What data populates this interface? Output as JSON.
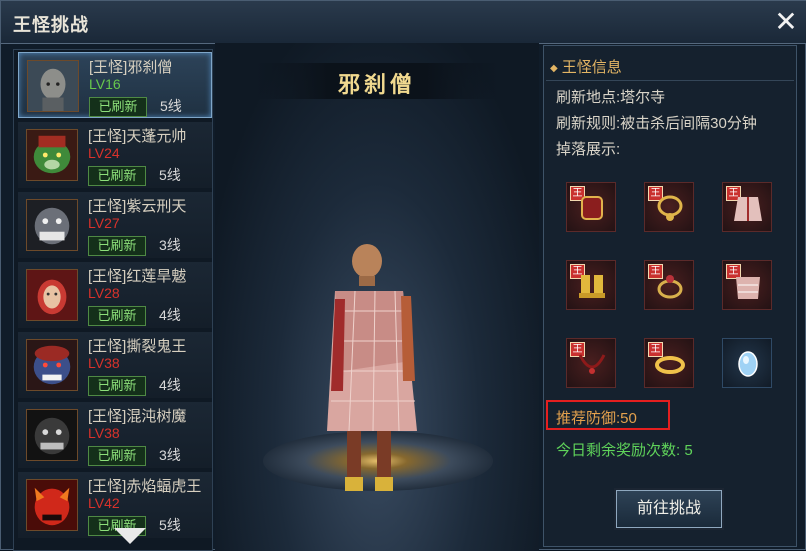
{
  "window": {
    "title": "王怪挑战"
  },
  "boss_list": [
    {
      "name": "[王怪]邪刹僧",
      "level": "LV16",
      "status": "已刷新",
      "line": "5线",
      "selected": true,
      "level_color": "#67c84c",
      "avatar_icon": "bald-monk-face-icon"
    },
    {
      "name": "[王怪]天蓬元帅",
      "level": "LV24",
      "status": "已刷新",
      "line": "5线",
      "level_color": "#d8322b",
      "avatar_icon": "green-boar-face-icon"
    },
    {
      "name": "[王怪]紫云刑天",
      "level": "LV27",
      "status": "已刷新",
      "line": "3线",
      "level_color": "#d8322b",
      "avatar_icon": "gray-demon-face-icon"
    },
    {
      "name": "[王怪]红莲旱魃",
      "level": "LV28",
      "status": "已刷新",
      "line": "4线",
      "level_color": "#d8322b",
      "avatar_icon": "red-haired-woman-face-icon"
    },
    {
      "name": "[王怪]撕裂鬼王",
      "level": "LV38",
      "status": "已刷新",
      "line": "4线",
      "level_color": "#d8322b",
      "avatar_icon": "blue-ghost-king-face-icon"
    },
    {
      "name": "[王怪]混沌树魔",
      "level": "LV38",
      "status": "已刷新",
      "line": "3线",
      "level_color": "#d8322b",
      "avatar_icon": "dark-tree-demon-face-icon"
    },
    {
      "name": "[王怪]赤焰蝠虎王",
      "level": "LV42",
      "status": "已刷新",
      "line": "5线",
      "level_color": "#d8322b",
      "avatar_icon": "red-bat-tiger-face-icon"
    }
  ],
  "preview": {
    "boss_name": "邪刹僧"
  },
  "info": {
    "title": "王怪信息",
    "refresh_location": "刷新地点:塔尔寺",
    "refresh_rule": "刷新规则:被击杀后间隔30分钟",
    "drops_label": "掉落展示:",
    "drops": [
      {
        "icon": "bracer-icon",
        "tag": "王"
      },
      {
        "icon": "necklace-icon",
        "tag": "王"
      },
      {
        "icon": "robe-icon",
        "tag": "王"
      },
      {
        "icon": "boots-icon",
        "tag": "王"
      },
      {
        "icon": "ring-icon",
        "tag": "王"
      },
      {
        "icon": "tunic-icon",
        "tag": "王"
      },
      {
        "icon": "amulet-cord-icon",
        "tag": "王"
      },
      {
        "icon": "gold-band-icon",
        "tag": "王"
      },
      {
        "icon": "blue-gem-icon",
        "tag": ""
      }
    ],
    "recommend_defense": "推荐防御:50",
    "remaining_rewards": "今日剩余奖励次数: 5",
    "go_button": "前往挑战"
  },
  "colors": {
    "gold_title": "#f1d98f",
    "status_green": "#8de07a",
    "highlight_red": "#e51f1f"
  }
}
